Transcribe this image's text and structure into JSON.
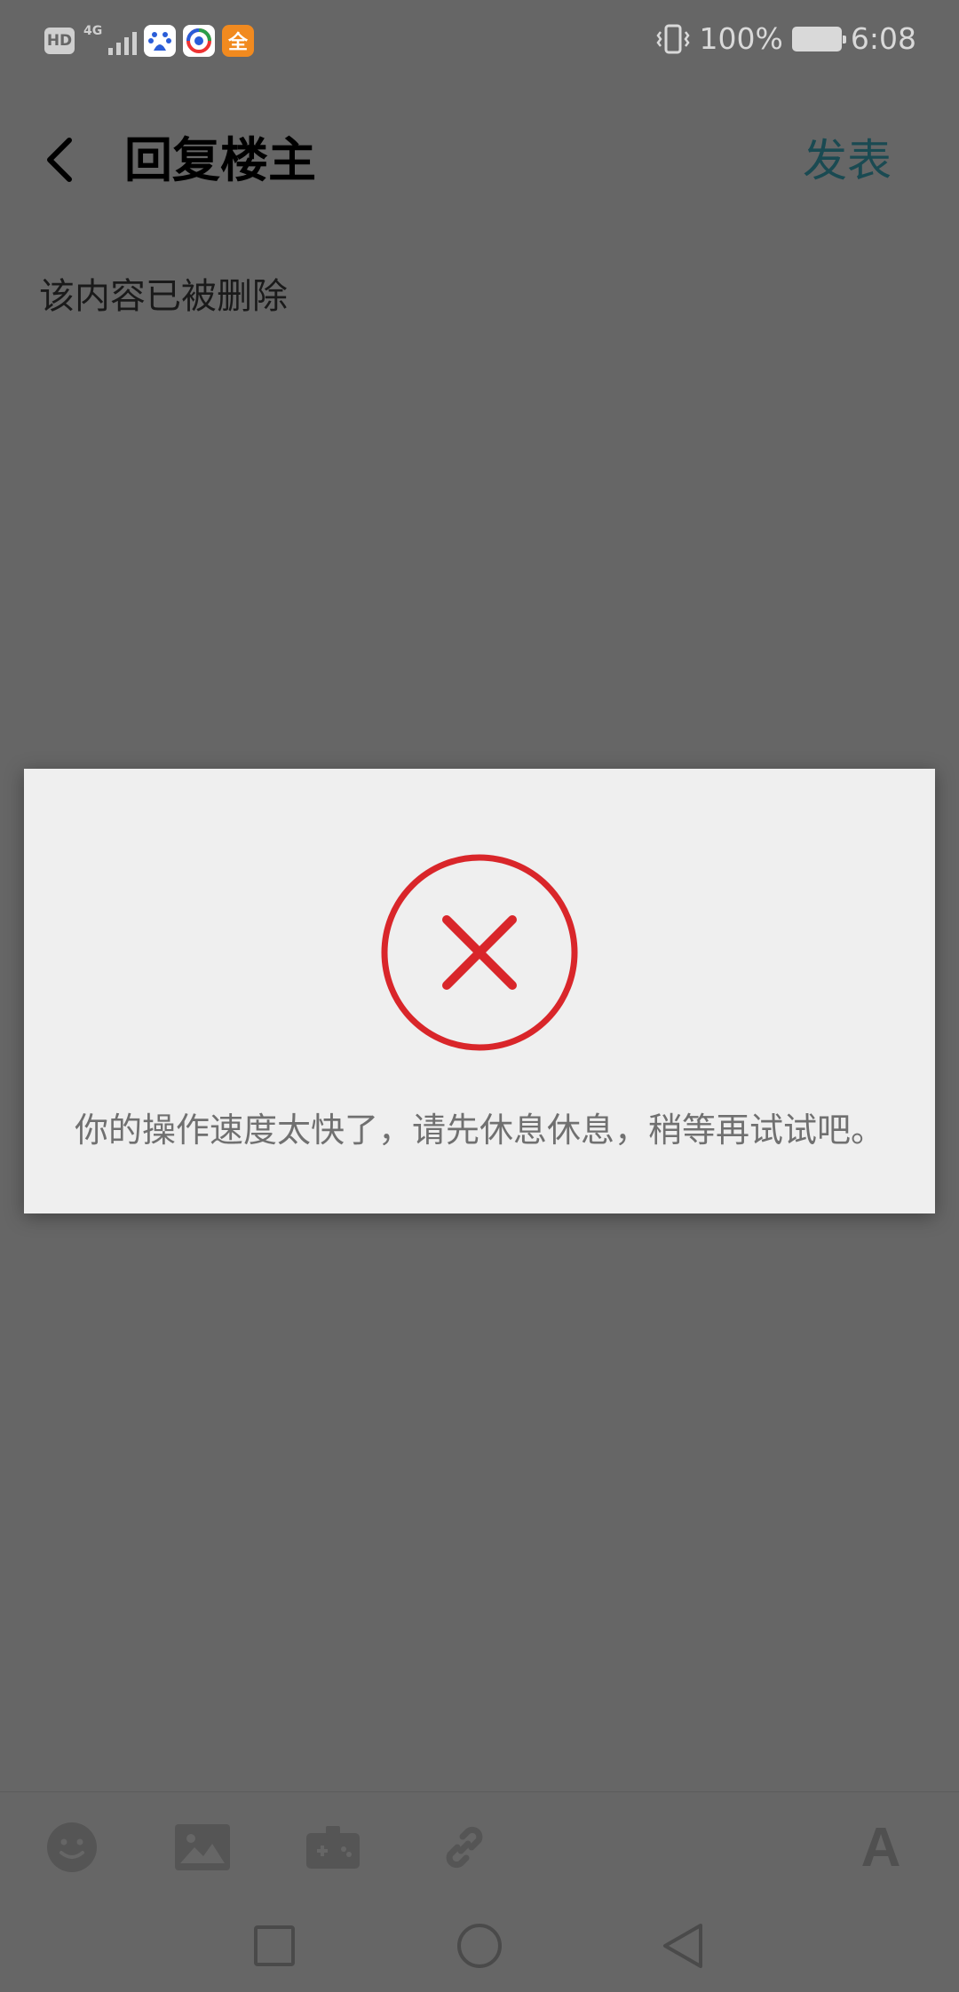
{
  "status_bar": {
    "hd_badge": "HD",
    "network": "4G",
    "app_icons": [
      {
        "name": "baidu-icon",
        "glyph": "du",
        "color": "#2a5dd8"
      },
      {
        "name": "browser-icon",
        "glyph": "◐",
        "color": "#3a9f4a"
      },
      {
        "name": "quan-icon",
        "glyph": "全",
        "color": "#f18a1f"
      }
    ],
    "battery_percent": "100%",
    "time": "6:08"
  },
  "header": {
    "title": "回复楼主",
    "publish_label": "发表"
  },
  "quote": {
    "text": "该内容已被删除"
  },
  "dialog": {
    "message": "你的操作速度太快了，请先休息休息，稍等再试试吧。",
    "icon": "error-x-icon",
    "icon_color": "#d9262a"
  },
  "toolbar": {
    "items": [
      "emoji-icon",
      "image-icon",
      "game-icon",
      "link-icon"
    ],
    "font_label": "A"
  },
  "colors": {
    "overlay_bg": "#666666",
    "dialog_bg": "#efefef",
    "accent": "#1a4a52"
  }
}
